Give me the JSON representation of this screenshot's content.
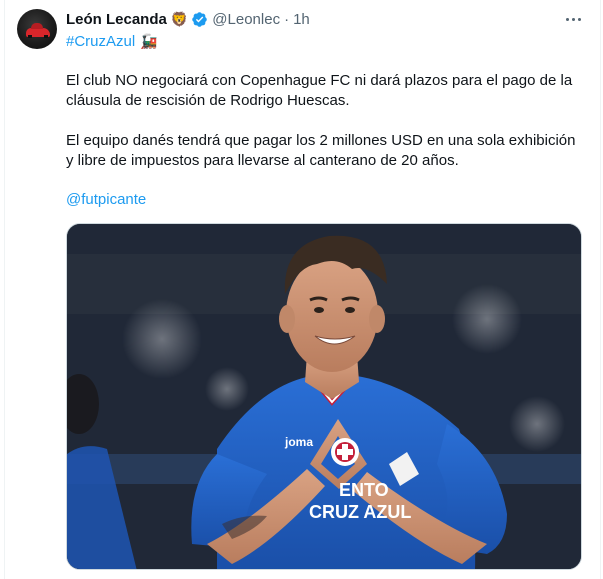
{
  "tweet": {
    "author_name": "León Lecanda",
    "name_emoji": "🦁",
    "handle": "@Leonlec",
    "separator": "·",
    "time": "1h",
    "hashtag": "#CruzAzul",
    "hashtag_emoji": "🚂",
    "paragraph1_lines": [
      "El club NO negociará con Copenhague FC ni dará plazos para el pago de la",
      "cláusula de rescisión de Rodrigo Huescas."
    ],
    "paragraph2_lines": [
      "El equipo danés tendrá que pagar los 2 millones USD en una sola exhibición",
      "y libre de impuestos para llevarse al canterano de 20 años."
    ],
    "mention": "@futpicante",
    "photo": {
      "jersey_brand": "joma",
      "jersey_sponsor": "ENTO",
      "jersey_team": "CRUZ AZUL",
      "jersey_color": "#1f5fc4"
    }
  },
  "icons": {
    "verified": "verified-badge-icon",
    "more": "more-options-icon"
  },
  "colors": {
    "link": "#1d9bf0",
    "text": "#0f1419",
    "secondary": "#536471"
  }
}
